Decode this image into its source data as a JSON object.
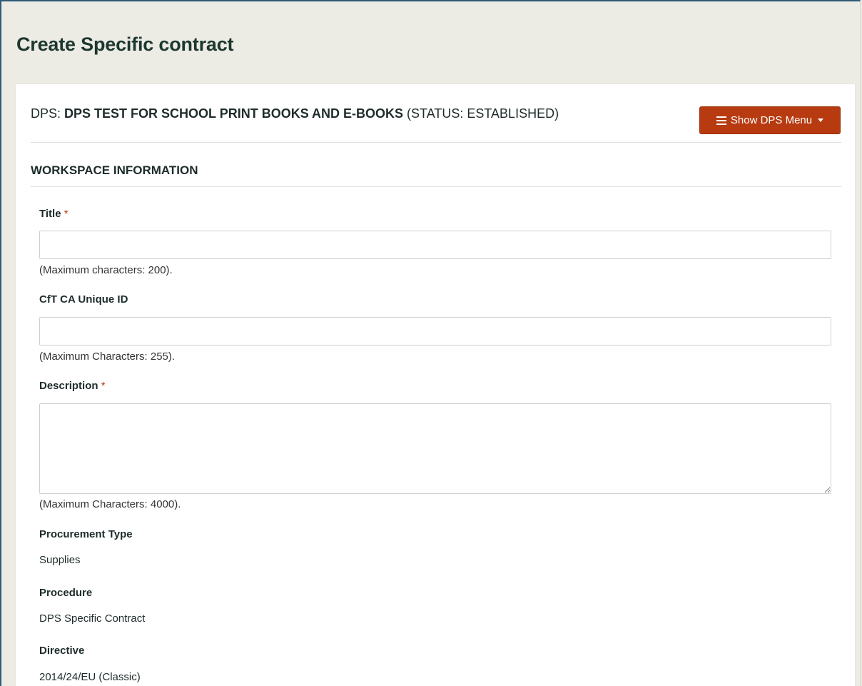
{
  "page": {
    "title": "Create Specific contract"
  },
  "dps": {
    "prefix": "DPS: ",
    "name": "DPS TEST FOR SCHOOL PRINT BOOKS AND E-BOOKS",
    "status": " (STATUS: ESTABLISHED)",
    "menu_button_label": "Show DPS Menu",
    "menu_button_color": "#b73a10"
  },
  "workspace": {
    "section_title": "WORKSPACE INFORMATION",
    "required_marker": "*",
    "title_field": {
      "label": "Title",
      "value": "",
      "hint": "(Maximum characters: 200)."
    },
    "unique_id_field": {
      "label": "CfT CA Unique ID",
      "value": "",
      "hint": "(Maximum Characters: 255)."
    },
    "description_field": {
      "label": "Description",
      "value": "",
      "hint": "(Maximum Characters: 4000)."
    },
    "procurement_type": {
      "label": "Procurement Type",
      "value": "Supplies"
    },
    "procedure": {
      "label": "Procedure",
      "value": "DPS Specific Contract"
    },
    "directive": {
      "label": "Directive",
      "value": "2014/24/EU (Classic)"
    }
  }
}
